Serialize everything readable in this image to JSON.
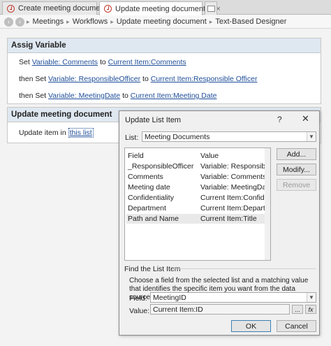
{
  "tabs": [
    {
      "label": "Create meeting document",
      "active": false
    },
    {
      "label": "Update meeting document *",
      "active": true,
      "close": "×"
    }
  ],
  "breadcrumb": {
    "back": "‹",
    "forward": "›",
    "items": [
      "Meetings",
      "Workflows",
      "Update meeting document",
      "Text-Based Designer"
    ],
    "separator": "▸"
  },
  "step1": {
    "title": "Assig Variable",
    "lines": [
      {
        "prefix": "Set ",
        "link1": "Variable: Comments",
        "mid": " to ",
        "link2": "Current Item:Comments"
      },
      {
        "prefix": "then Set ",
        "link1": "Variable: ResponsibleOfficer",
        "mid": " to ",
        "link2": "Current Item:Responsible Officer"
      },
      {
        "prefix": "then Set ",
        "link1": "Variable: MeetingDate",
        "mid": " to ",
        "link2": "Current Item:Meeting Date"
      }
    ]
  },
  "step2": {
    "title": "Update meeting document",
    "prefix": "Update item in ",
    "link": "this list"
  },
  "dialog": {
    "title": "Update List Item",
    "help": "?",
    "close": "✕",
    "list_label": "List:",
    "list_value": "Meeting Documents",
    "columns": {
      "field": "Field",
      "value": "Value"
    },
    "rows": [
      {
        "field": "_ResponsibleOfficer",
        "value": "Variable: ResponsibleO..."
      },
      {
        "field": "Comments",
        "value": "Variable: Comments"
      },
      {
        "field": "Meeting date",
        "value": "Variable: MeetingDate"
      },
      {
        "field": "Confidentiality",
        "value": "Current Item:Confiden..."
      },
      {
        "field": "Department",
        "value": "Current Item:Departm..."
      },
      {
        "field": "Path and Name",
        "value": "Current Item:Title"
      }
    ],
    "buttons": {
      "add": "Add...",
      "modify": "Modify...",
      "remove": "Remove",
      "ok": "OK",
      "cancel": "Cancel"
    },
    "find_group": "Find the List Item",
    "find_hint": "Choose a field from the selected list and a matching value that identifies the specific item you want from the data source:",
    "field_label": "Field:",
    "field_value": "MeetingID",
    "value_label": "Value:",
    "value_value": "Current Item:ID",
    "ellipsis": "...",
    "fx": "fx"
  },
  "colors": {
    "link": "#1f4e99",
    "header_bg": "#dfe8f1",
    "workflow_icon": "#c0392b"
  }
}
